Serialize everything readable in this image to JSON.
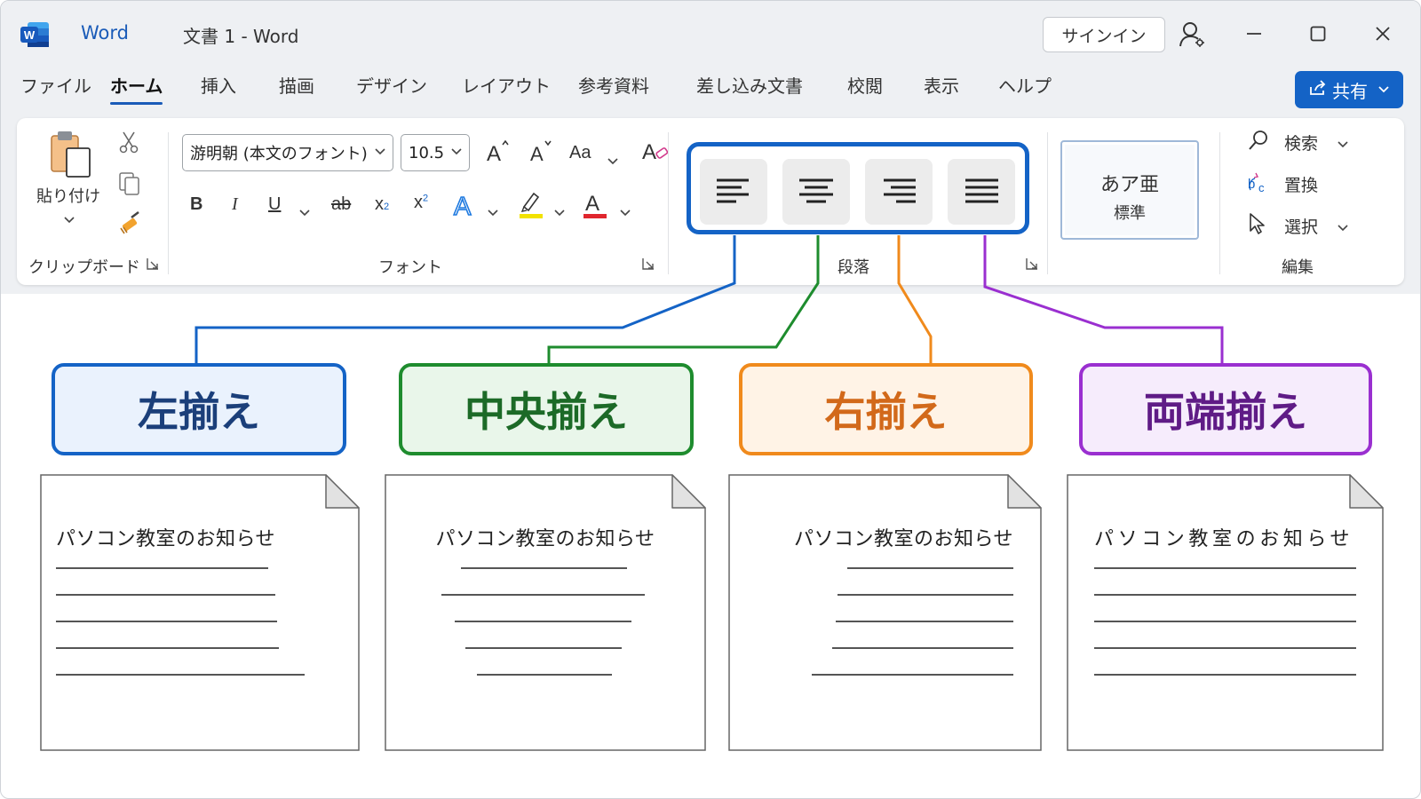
{
  "window": {
    "app_name": "Word",
    "doc_title": "文書 1  -  Word",
    "signin_label": "サインイン"
  },
  "tabs": [
    {
      "label": "ファイル",
      "active": false
    },
    {
      "label": "ホーム",
      "active": true
    },
    {
      "label": "挿入",
      "active": false
    },
    {
      "label": "描画",
      "active": false
    },
    {
      "label": "デザイン",
      "active": false
    },
    {
      "label": "レイアウト",
      "active": false
    },
    {
      "label": "参考資料",
      "active": false
    },
    {
      "label": "差し込み文書",
      "active": false
    },
    {
      "label": "校閲",
      "active": false
    },
    {
      "label": "表示",
      "active": false
    },
    {
      "label": "ヘルプ",
      "active": false
    }
  ],
  "share_label": "共有",
  "ribbon": {
    "clipboard": {
      "paste_label": "貼り付け",
      "group_label": "クリップボード"
    },
    "font": {
      "font_name": "游明朝 (本文のフォント)",
      "font_size": "10.5",
      "change_case_label": "Aa",
      "group_label": "フォント",
      "font_color": "#e0262e",
      "highlight_color": "#f2e200"
    },
    "paragraph": {
      "group_label": "段落"
    },
    "styles": {
      "sample": "あア亜",
      "name": "標準"
    },
    "editing": {
      "find_label": "検索",
      "replace_label": "置換",
      "select_label": "選択",
      "group_label": "編集"
    }
  },
  "callouts": [
    {
      "label": "左揃え",
      "color": "#1463c6",
      "bg": "#eaf2fd",
      "text_color": "#1b3f7a"
    },
    {
      "label": "中央揃え",
      "color": "#1e8c2e",
      "bg": "#e9f6ea",
      "text_color": "#1c6a27"
    },
    {
      "label": "右揃え",
      "color": "#f08a1c",
      "bg": "#fff3e6",
      "text_color": "#d2691a"
    },
    {
      "label": "両端揃え",
      "color": "#9a2fd0",
      "bg": "#f6ecfc",
      "text_color": "#5f1b86"
    }
  ],
  "documents": [
    {
      "title": "パソコン教室のお知らせ",
      "align": "left"
    },
    {
      "title": "パソコン教室のお知らせ",
      "align": "center"
    },
    {
      "title": "パソコン教室のお知らせ",
      "align": "right"
    },
    {
      "title": "パソコン教室のお知らせ",
      "align": "justify"
    }
  ]
}
